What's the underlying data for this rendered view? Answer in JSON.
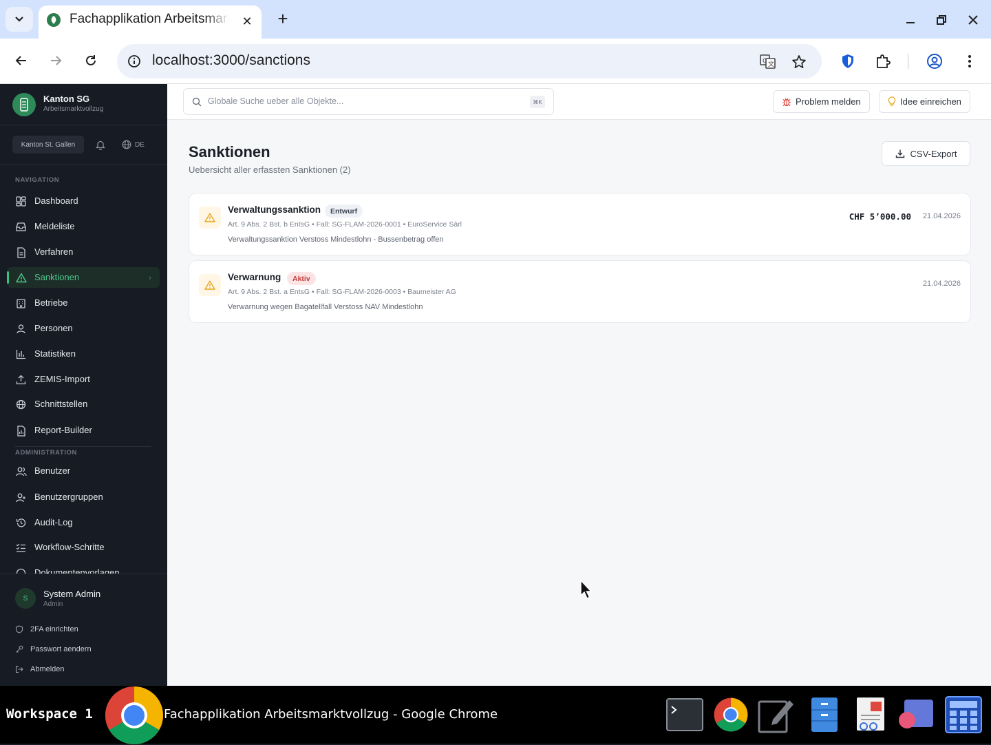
{
  "browser": {
    "tab_title": "Fachapplikation Arbeitsmarktvollzug",
    "url": "localhost:3000/sanctions"
  },
  "sidebar": {
    "brand_name": "Kanton SG",
    "brand_sub": "Arbeitsmarktvollzug",
    "tenant": "Kanton St. Gallen",
    "language": "DE",
    "nav_label": "NAVIGATION",
    "nav_items": [
      {
        "label": "Dashboard",
        "icon": "dashboard-icon"
      },
      {
        "label": "Meldeliste",
        "icon": "inbox-icon"
      },
      {
        "label": "Verfahren",
        "icon": "file-icon"
      },
      {
        "label": "Sanktionen",
        "icon": "warning-icon",
        "active": true
      },
      {
        "label": "Betriebe",
        "icon": "building-icon"
      },
      {
        "label": "Personen",
        "icon": "user-icon"
      },
      {
        "label": "Statistiken",
        "icon": "bar-chart-icon"
      },
      {
        "label": "ZEMIS-Import",
        "icon": "upload-icon"
      },
      {
        "label": "Schnittstellen",
        "icon": "globe-icon"
      },
      {
        "label": "Report-Builder",
        "icon": "report-icon"
      }
    ],
    "admin_label": "ADMINISTRATION",
    "admin_items": [
      {
        "label": "Benutzer",
        "icon": "users-icon"
      },
      {
        "label": "Benutzergruppen",
        "icon": "user-group-icon"
      },
      {
        "label": "Audit-Log",
        "icon": "history-icon"
      },
      {
        "label": "Workflow-Schritte",
        "icon": "list-check-icon"
      },
      {
        "label": "Dokumentenvorlagen",
        "icon": "template-icon"
      }
    ],
    "user": {
      "initial": "S",
      "name": "System Admin",
      "role": "Admin"
    },
    "account_links": [
      {
        "label": "2FA einrichten",
        "icon": "shield-icon"
      },
      {
        "label": "Passwort aendern",
        "icon": "key-icon"
      },
      {
        "label": "Abmelden",
        "icon": "logout-icon"
      }
    ]
  },
  "topbar": {
    "search_placeholder": "Globale Suche ueber alle Objekte...",
    "search_shortcut": "⌘K",
    "report_problem": "Problem melden",
    "submit_idea": "Idee einreichen"
  },
  "page": {
    "title": "Sanktionen",
    "subtitle": "Uebersicht aller erfassten Sanktionen (2)",
    "export_label": "CSV-Export"
  },
  "sanctions": [
    {
      "title": "Verwaltungssanktion",
      "badge": "Entwurf",
      "badge_kind": "draft",
      "meta": "Art. 9 Abs. 2 Bst. b EntsG • Fall: SG-FLAM-2026-0001 • EuroService Sàrl",
      "description": "Verwaltungssanktion Verstoss Mindestlohn - Bussenbetrag offen",
      "amount": "CHF 5’000.00",
      "date": "21.04.2026"
    },
    {
      "title": "Verwarnung",
      "badge": "Aktiv",
      "badge_kind": "active",
      "meta": "Art. 9 Abs. 2 Bst. a EntsG • Fall: SG-FLAM-2026-0003 • Baumeister AG",
      "description": "Verwarnung wegen Bagatellfall Verstoss NAV Mindestlohn",
      "amount": "",
      "date": "21.04.2026"
    }
  ],
  "taskbar": {
    "workspace": "Workspace 1",
    "window_title": "Fachapplikation Arbeitsmarktvollzug - Google Chrome"
  },
  "colors": {
    "sidebar_bg": "#171b24",
    "accent_green": "#3fbf7f",
    "warning_amber": "#e8a317",
    "active_badge_red": "#c23b3b"
  }
}
